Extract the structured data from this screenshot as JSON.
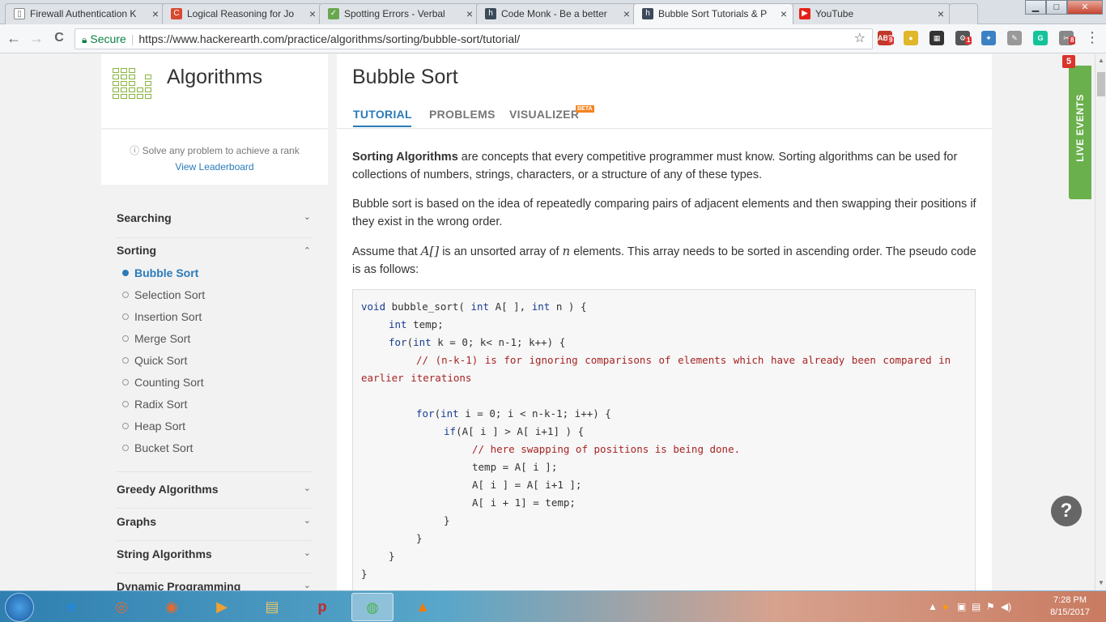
{
  "browser": {
    "tabs": [
      {
        "title": "Firewall Authentication K",
        "icon": "document-icon",
        "active": false
      },
      {
        "title": "Logical Reasoning for Jo",
        "icon": "c-favicon",
        "active": false
      },
      {
        "title": "Spotting Errors - Verbal",
        "icon": "indiabix-favicon",
        "active": false
      },
      {
        "title": "Code Monk - Be a better",
        "icon": "hackerearth-favicon",
        "active": false
      },
      {
        "title": "Bubble Sort Tutorials & P",
        "icon": "hackerearth-favicon",
        "active": true
      },
      {
        "title": "YouTube",
        "icon": "youtube-favicon",
        "active": false
      }
    ],
    "tab_close": "×",
    "back": "←",
    "forward": "→",
    "reload": "C",
    "secure_label": "Secure",
    "url": "https://www.hackerearth.com/practice/algorithms/sorting/bubble-sort/tutorial/",
    "extensions": [
      {
        "name": "adblock-icon",
        "label": "ABP",
        "badge": "9",
        "color": "#c0392b"
      },
      {
        "name": "norton-icon",
        "label": "●",
        "badge": "",
        "color": "#e0b72b"
      },
      {
        "name": "film-icon",
        "label": "▦",
        "badge": "",
        "color": "#333333"
      },
      {
        "name": "extension-red-icon",
        "label": "⚙",
        "badge": "1",
        "color": "#555555"
      },
      {
        "name": "extension-blue-icon",
        "label": "✦",
        "badge": "",
        "color": "#3b82c4"
      },
      {
        "name": "pdf-icon",
        "label": "✎",
        "badge": "",
        "color": "#999999"
      },
      {
        "name": "grammarly-icon",
        "label": "G",
        "badge": "",
        "color": "#15c39a"
      },
      {
        "name": "extension-gray-icon",
        "label": "✂",
        "badge": "8",
        "color": "#888888"
      }
    ],
    "menu": "⋮",
    "window_controls": {
      "minimize": "▁",
      "maximize": "□",
      "close": "✕"
    }
  },
  "sidebar": {
    "title": "Algorithms",
    "rank_text": "Solve any problem to achieve a rank",
    "leaderboard_link": "View Leaderboard",
    "categories": [
      {
        "label": "Searching",
        "chevron": "⌄"
      },
      {
        "label": "Sorting",
        "chevron": "⌃"
      },
      {
        "label": "Greedy Algorithms",
        "chevron": "⌄"
      },
      {
        "label": "Graphs",
        "chevron": "⌄"
      },
      {
        "label": "String Algorithms",
        "chevron": "⌄"
      },
      {
        "label": "Dynamic Programming",
        "chevron": "⌄"
      }
    ],
    "sorting_items": [
      {
        "label": "Bubble Sort",
        "active": true
      },
      {
        "label": "Selection Sort",
        "active": false
      },
      {
        "label": "Insertion Sort",
        "active": false
      },
      {
        "label": "Merge Sort",
        "active": false
      },
      {
        "label": "Quick Sort",
        "active": false
      },
      {
        "label": "Counting Sort",
        "active": false
      },
      {
        "label": "Radix Sort",
        "active": false
      },
      {
        "label": "Heap Sort",
        "active": false
      },
      {
        "label": "Bucket Sort",
        "active": false
      }
    ]
  },
  "main": {
    "title": "Bubble Sort",
    "tabs": [
      "TUTORIAL",
      "PROBLEMS",
      "VISUALIZER"
    ],
    "beta_badge": "BETA",
    "para1_bold": "Sorting Algorithms",
    "para1_rest": " are concepts that every competitive programmer must know. Sorting algorithms can be used for collections of numbers, strings, characters, or a structure of any of these types.",
    "para2": "Bubble sort is based on the idea of repeatedly comparing pairs of adjacent elements and then swapping their positions if they exist in the wrong order.",
    "para3_a": "Assume that ",
    "para3_var1": "A[]",
    "para3_b": " is an unsorted array of ",
    "para3_var2": "n",
    "para3_c": " elements. This array needs to be sorted in ascending order. The pseudo code is as follows:",
    "code": {
      "line1_kw1": "void",
      "line1_a": " bubble_sort( ",
      "line1_kw2": "int",
      "line1_b": " A[ ], ",
      "line1_kw3": "int",
      "line1_c": " n ) {",
      "line2_kw": "int",
      "line2_rest": " temp;",
      "line3_kw": "for",
      "line3_a": "(",
      "line3_kw2": "int",
      "line3_b": " k = 0; k< n-1; k++) {",
      "line4_comment": "// (n-k-1) is for ignoring comparisons of elements which have already been compared in earlier iterations",
      "line5_kw": "for",
      "line5_a": "(",
      "line5_kw2": "int",
      "line5_b": " i = 0; i < n-k-1; i++) {",
      "line6_kw": "if",
      "line6_rest": "(A[ i ] > A[ i+1] ) {",
      "line7_comment": "// here swapping of positions is being done.",
      "line8": "temp = A[ i ];",
      "line9": "A[ i ] = A[ i+1 ];",
      "line10": "A[ i + 1] = temp;",
      "brace": "}"
    }
  },
  "live_events": {
    "label": "LIVE EVENTS",
    "count": "5"
  },
  "help": "?",
  "taskbar": {
    "time": "7:28 PM",
    "date": "8/15/2017",
    "apps": [
      {
        "name": "ie-app",
        "label": "e",
        "color": "#1e88e5"
      },
      {
        "name": "camera-app",
        "label": "◎",
        "color": "#e8692c"
      },
      {
        "name": "capture-app",
        "label": "◉",
        "color": "#e8692c"
      },
      {
        "name": "media-player-app",
        "label": "▶",
        "color": "#f0a030"
      },
      {
        "name": "explorer-app",
        "label": "▤",
        "color": "#e9c46a"
      },
      {
        "name": "p-app",
        "label": "p",
        "color": "#c62828"
      },
      {
        "name": "chrome-app",
        "label": "◍",
        "color": "#4caf50"
      },
      {
        "name": "vlc-app",
        "label": "▲",
        "color": "#f57c00"
      }
    ]
  }
}
